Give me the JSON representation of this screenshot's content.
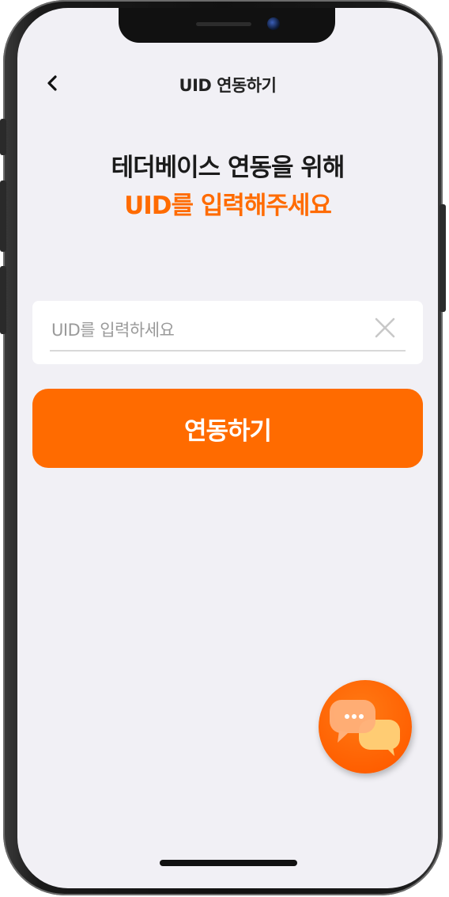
{
  "header": {
    "title": "UID 연동하기"
  },
  "headline": {
    "line1": "테더베이스 연동을 위해",
    "line2": "UID를 입력해주세요"
  },
  "form": {
    "uid_value": "",
    "uid_placeholder": "UID를 입력하세요"
  },
  "cta": {
    "label": "연동하기"
  },
  "icons": {
    "back": "chevron-left-icon",
    "clear": "close-icon",
    "chat": "chat-bubbles-icon"
  },
  "colors": {
    "accent": "#ff6b00",
    "screen_bg": "#f1f0f5",
    "text_dark": "#1b1b1b",
    "placeholder": "#9a9a9a"
  }
}
